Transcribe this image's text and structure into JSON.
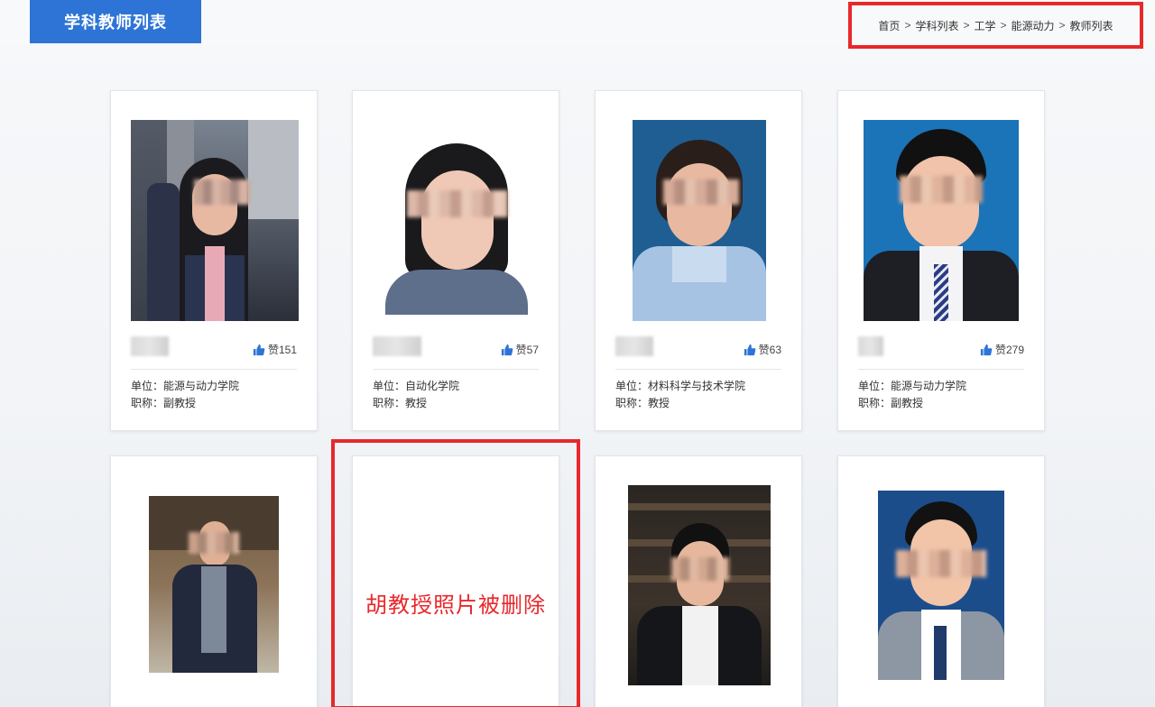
{
  "header": {
    "title": "学科教师列表",
    "breadcrumb": [
      "首页",
      "学科列表",
      "工学",
      "能源动力",
      "教师列表"
    ],
    "breadcrumb_separator": ">"
  },
  "labels": {
    "unit_prefix": "单位：",
    "title_prefix": "职称：",
    "like_prefix": "赞"
  },
  "cards": [
    {
      "likes": "151",
      "unit": "能源与动力学院",
      "title": "副教授"
    },
    {
      "likes": "57",
      "unit": "自动化学院",
      "title": "教授"
    },
    {
      "likes": "63",
      "unit": "材料科学与技术学院",
      "title": "教授"
    },
    {
      "likes": "279",
      "unit": "能源与动力学院",
      "title": "副教授"
    }
  ],
  "annotation": {
    "deleted_text": "胡教授照片被删除"
  },
  "colors": {
    "brand": "#2d74d6",
    "highlight": "#e8282c",
    "like": "#2d74d6"
  }
}
